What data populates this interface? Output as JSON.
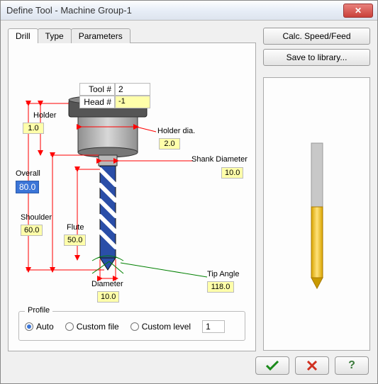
{
  "window": {
    "title": "Define Tool - Machine Group-1"
  },
  "tabs": {
    "drill": "Drill",
    "type": "Type",
    "parameters": "Parameters",
    "active": "drill"
  },
  "buttons": {
    "calc": "Calc. Speed/Feed",
    "save": "Save to library..."
  },
  "labels": {
    "tool_num": "Tool #",
    "head_num": "Head #",
    "holder": "Holder",
    "holder_dia": "Holder dia.",
    "shank_dia": "Shank Diameter",
    "overall": "Overall",
    "shoulder": "Shoulder",
    "flute": "Flute",
    "diameter": "Diameter",
    "tip_angle": "Tip Angle",
    "profile": "Profile",
    "auto": "Auto",
    "custom_file": "Custom file",
    "custom_level": "Custom level"
  },
  "values": {
    "tool_num": "2",
    "head_num": "-1",
    "holder": "1.0",
    "holder_dia": "2.0",
    "shank_dia": "10.0",
    "overall": "80.0",
    "shoulder": "60.0",
    "flute": "50.0",
    "diameter": "10.0",
    "tip_angle": "118.0",
    "custom_level": "1"
  },
  "profile_selected": "auto"
}
